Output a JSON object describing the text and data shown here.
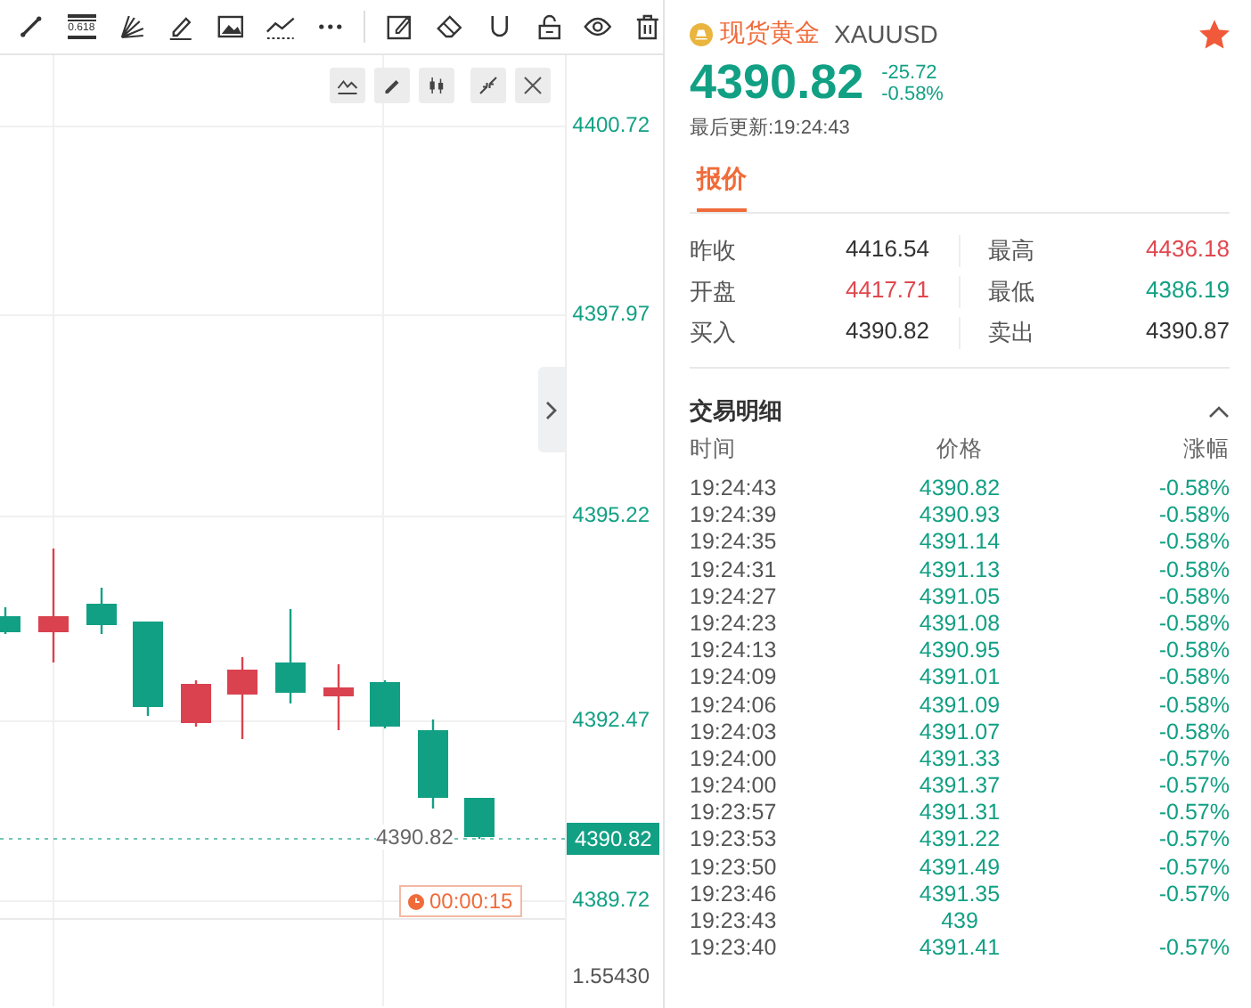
{
  "toolbar": {
    "fibonacci_label": "0.618"
  },
  "chart": {
    "y_axis_labels": [
      "4400.72",
      "4397.97",
      "4395.22",
      "4392.47",
      "4389.72"
    ],
    "current_price_tag": "4390.82",
    "last_price_label": "4390.82",
    "countdown": "00:00:15",
    "indicator_value": "1.55430"
  },
  "quote": {
    "name": "现货黄金",
    "symbol": "XAUUSD",
    "favorite": true,
    "price": "4390.82",
    "change": "-25.72",
    "change_percent": "-0.58%",
    "updated": "最后更新:19:24:43",
    "tabs": [
      {
        "label": "报价",
        "selected": true
      }
    ],
    "stats": [
      {
        "label": "昨收",
        "value": "4416.54",
        "color": "#333333"
      },
      {
        "label": "最高",
        "value": "4436.18",
        "color": "#e0474f"
      },
      {
        "label": "开盘",
        "value": "4417.71",
        "color": "#e0474f"
      },
      {
        "label": "最低",
        "value": "4386.19",
        "color": "#12a084"
      },
      {
        "label": "买入",
        "value": "4390.82",
        "color": "#333333"
      },
      {
        "label": "卖出",
        "value": "4390.87",
        "color": "#333333"
      }
    ]
  },
  "trades": {
    "title": "交易明细",
    "expanded": true,
    "columns": [
      "时间",
      "价格",
      "涨幅"
    ],
    "rows": [
      {
        "time": "19:24:43",
        "price": "4390.82",
        "change": "-0.58%"
      },
      {
        "time": "19:24:39",
        "price": "4390.93",
        "change": "-0.58%"
      },
      {
        "time": "19:24:35",
        "price": "4391.14",
        "change": "-0.58%"
      },
      {
        "time": "19:24:31",
        "price": "4391.13",
        "change": "-0.58%"
      },
      {
        "time": "19:24:27",
        "price": "4391.05",
        "change": "-0.58%"
      },
      {
        "time": "19:24:23",
        "price": "4391.08",
        "change": "-0.58%"
      },
      {
        "time": "19:24:13",
        "price": "4390.95",
        "change": "-0.58%"
      },
      {
        "time": "19:24:09",
        "price": "4391.01",
        "change": "-0.58%"
      },
      {
        "time": "19:24:06",
        "price": "4391.09",
        "change": "-0.58%"
      },
      {
        "time": "19:24:03",
        "price": "4391.07",
        "change": "-0.58%"
      },
      {
        "time": "19:24:00",
        "price": "4391.33",
        "change": "-0.57%"
      },
      {
        "time": "19:24:00",
        "price": "4391.37",
        "change": "-0.57%"
      },
      {
        "time": "19:23:57",
        "price": "4391.31",
        "change": "-0.57%"
      },
      {
        "time": "19:23:53",
        "price": "4391.22",
        "change": "-0.57%"
      },
      {
        "time": "19:23:50",
        "price": "4391.49",
        "change": "-0.57%"
      },
      {
        "time": "19:23:46",
        "price": "4391.35",
        "change": "-0.57%"
      },
      {
        "time": "19:23:43",
        "price": "439"
      },
      {
        "time": "19:23:40",
        "price": "4391.41",
        "change": "-0.57%"
      }
    ]
  }
}
